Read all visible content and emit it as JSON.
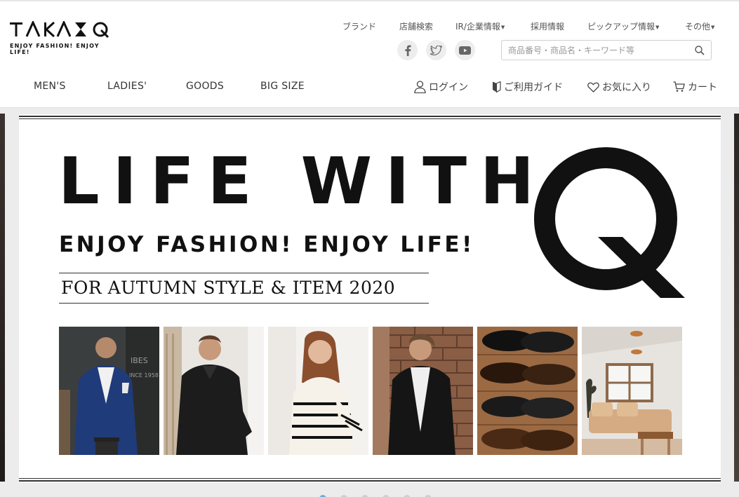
{
  "header": {
    "logo_main": "TAKA-Q",
    "logo_tagline": "ENJOY FASHION! ENJOY LIFE!",
    "util_links": [
      "ブランド",
      "店舗検索",
      "IR/企業情報",
      "採用情報",
      "ピックアップ情報",
      "その他"
    ],
    "search_placeholder": "商品番号・商品名・キーワード等",
    "social_icons": [
      "facebook-icon",
      "twitter-icon",
      "youtube-icon"
    ]
  },
  "main_nav": [
    "MEN'S",
    "LADIES'",
    "GOODS",
    "BIG SIZE"
  ],
  "account_nav": {
    "login": "ログイン",
    "guide": "ご利用ガイド",
    "favorites": "お気に入り",
    "cart": "カート"
  },
  "banner": {
    "headline": "LIFE WITH",
    "big_letter": "Q",
    "tagline": "ENJOY FASHION!  ENJOY LIFE!",
    "subtitle": "FOR AUTUMN STYLE & ITEM 2020",
    "photos": [
      "men-blazer-photo",
      "men-knit-photo",
      "ladies-sweater-photo",
      "men-leather-jacket-photo",
      "leather-shoes-photo",
      "living-room-photo"
    ]
  },
  "carousel": {
    "slide_count": 6,
    "active_index": 0
  },
  "colors": {
    "accent_dot": "#6ab0d8",
    "text_dark": "#111111",
    "muted_text": "#555555"
  }
}
